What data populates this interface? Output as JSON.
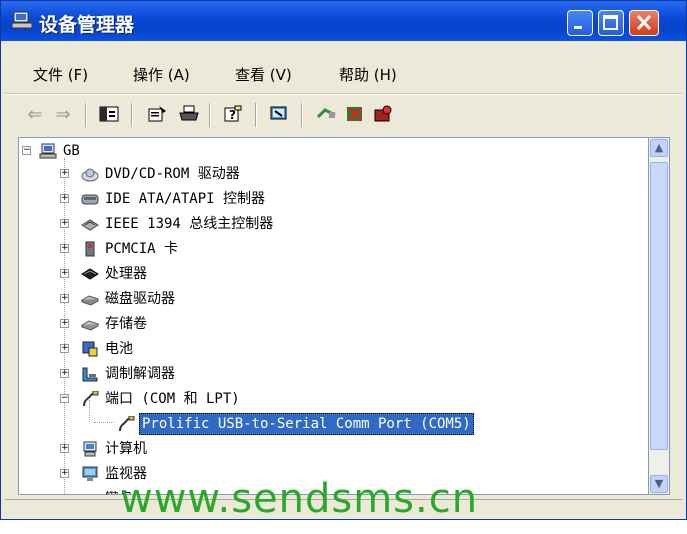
{
  "window": {
    "title": "设备管理器"
  },
  "menu": [
    {
      "label": "文件 (F)"
    },
    {
      "label": "操作 (A)"
    },
    {
      "label": "查看 (V)"
    },
    {
      "label": "帮助 (H)"
    }
  ],
  "tree": {
    "root": "GB",
    "items": [
      {
        "label": "DVD/CD-ROM 驱动器",
        "icon": "cdrom-icon"
      },
      {
        "label": "IDE ATA/ATAPI 控制器",
        "icon": "ide-controller-icon"
      },
      {
        "label": "IEEE 1394 总线主控制器",
        "icon": "ieee1394-icon"
      },
      {
        "label": "PCMCIA 卡",
        "icon": "pcmcia-icon"
      },
      {
        "label": "处理器",
        "icon": "processor-icon"
      },
      {
        "label": "磁盘驱动器",
        "icon": "disk-drive-icon"
      },
      {
        "label": "存储卷",
        "icon": "storage-volume-icon"
      },
      {
        "label": "电池",
        "icon": "battery-icon"
      },
      {
        "label": "调制解调器",
        "icon": "modem-icon"
      },
      {
        "label": "端口 (COM 和 LPT)",
        "icon": "port-icon",
        "expanded": true
      },
      {
        "label": "Prolific USB-to-Serial Comm Port (COM5)",
        "icon": "port-icon",
        "child": true,
        "selected": true
      },
      {
        "label": "计算机",
        "icon": "computer-icon"
      },
      {
        "label": "监视器",
        "icon": "monitor-icon"
      },
      {
        "label": "键盘",
        "icon": "keyboard-icon",
        "partial": true
      }
    ]
  },
  "watermark": "www.sendsms.cn",
  "colors": {
    "titlebar": "#0a4ad8",
    "selection": "#316ac5",
    "watermark": "#29a829"
  }
}
